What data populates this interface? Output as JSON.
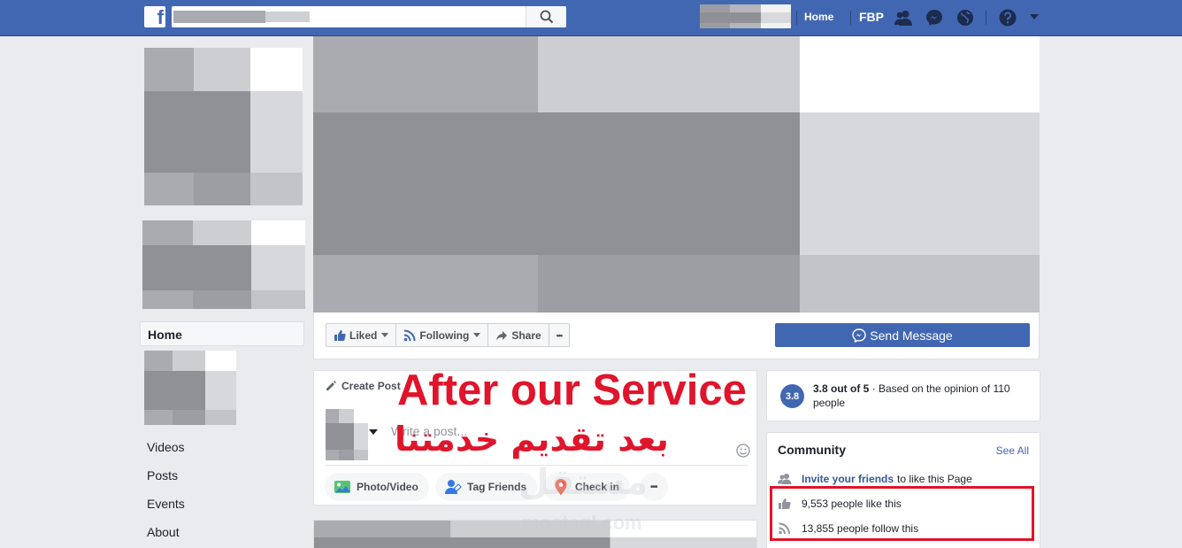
{
  "topbar": {
    "logo_letter": "f",
    "nav_home": "Home",
    "nav_page": "FBP"
  },
  "left_nav": {
    "home": "Home",
    "links": [
      "Videos",
      "Posts",
      "Events",
      "About"
    ]
  },
  "page_actions": {
    "liked": "Liked",
    "following": "Following",
    "share": "Share",
    "more": "•••",
    "send_message": "Send Message"
  },
  "create_post": {
    "title": "Create Post",
    "placeholder": "Write a post...",
    "chips": [
      "Photo/Video",
      "Tag Friends",
      "Check in",
      "•••"
    ]
  },
  "rating": {
    "score": "3.8",
    "summary_bold": "3.8 out of 5",
    "summary_rest": " · Based on the opinion of 110 people"
  },
  "community": {
    "title": "Community",
    "see_all": "See All",
    "invite_link": "Invite your friends",
    "invite_rest": "to like this Page",
    "likes": "9,553 people like this",
    "follows": "13,855 people follow this"
  },
  "overlay": {
    "english": "After our Service",
    "arabic": "بعد تقديم خدمتنا",
    "watermark_arabic": "مستقل",
    "watermark_english": "mostaql.com"
  },
  "colors": {
    "brand_blue": "#4267b2",
    "highlight_red": "#e0142b",
    "page_bg": "#e9ebee"
  }
}
